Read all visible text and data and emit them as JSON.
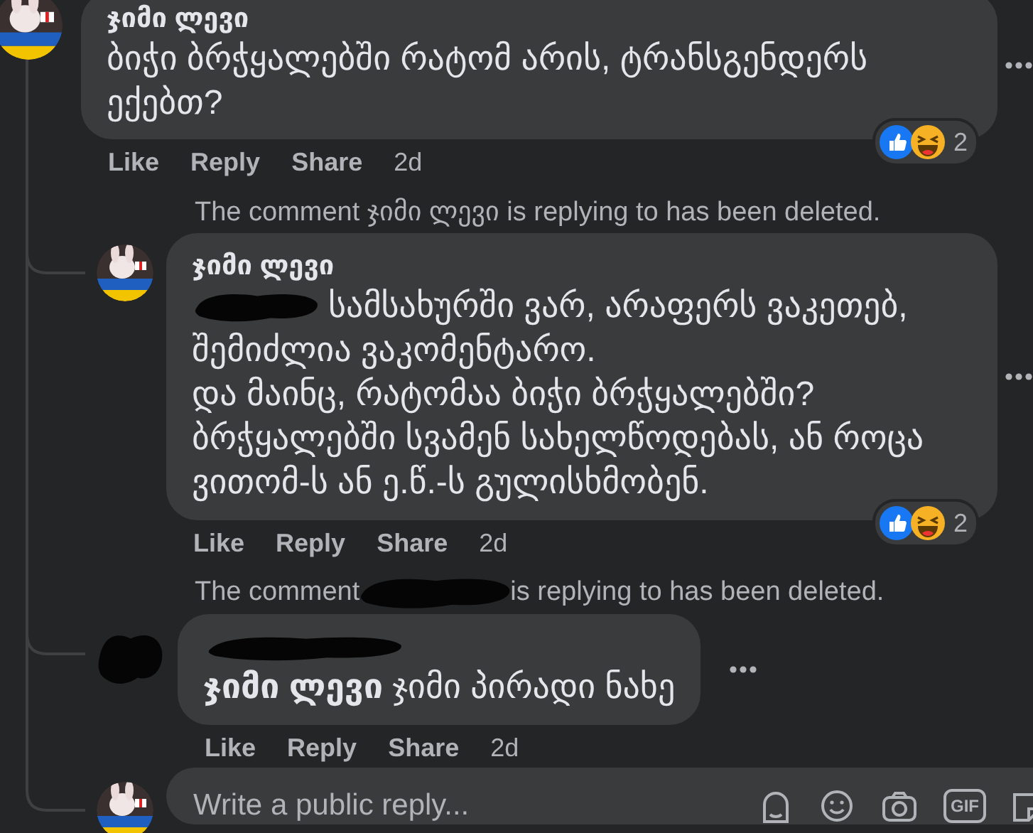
{
  "comment": {
    "avatar": {
      "kind": "picture"
    },
    "name": "ჯიმი ლევი",
    "body": "ბიჭი ბრჭყალებში რატომ არის, ტრანსგენდერს ექებთ?",
    "reactions": {
      "count": "2"
    },
    "actions": [
      "Like",
      "Reply",
      "Share"
    ],
    "time": "2d",
    "more_button": true
  },
  "replies": [
    {
      "kind": "notice",
      "before": "The comment",
      "author": "ჯიმი ლევი",
      "after": "is replying to has been deleted."
    },
    {
      "kind": "comment",
      "avatar": {
        "kind": "picture"
      },
      "name": "ჯიმი ლევი",
      "after_redaction": "სამსახურში ვარ, არაფერს ვაკეთებ,",
      "body": "შემიძლია ვაკომენტარო.\nდა მაინც, რატომაა ბიჭი ბრჭყალებში? ბრჭყალებში სვამენ სახელწოდებას, ან როცა ვითომ-ს ან ე.წ.-ს გულისხმობენ.",
      "reactions": {
        "count": "2"
      },
      "actions": [
        "Like",
        "Reply",
        "Share"
      ],
      "time": "2d",
      "more_button": true
    },
    {
      "kind": "notice",
      "before": "The comment",
      "redacted": true,
      "after": "is replying to has been deleted."
    },
    {
      "kind": "comment",
      "avatar": {
        "kind": "redacted"
      },
      "name_redacted": true,
      "body": "**ჯიმი ლევი** ჯიმი პირადი ნახე",
      "actions": [
        "Like",
        "Reply",
        "Share"
      ],
      "time": "2d",
      "more_button": true
    }
  ],
  "reply_box": {
    "avatar": {
      "kind": "picture"
    },
    "placeholder": "Write a public reply...",
    "tools": [
      {
        "kind": "avatar"
      },
      {
        "kind": "emoji"
      },
      {
        "kind": "camera"
      },
      {
        "kind": "gif",
        "label": "GIF"
      },
      {
        "kind": "sticker"
      }
    ]
  }
}
